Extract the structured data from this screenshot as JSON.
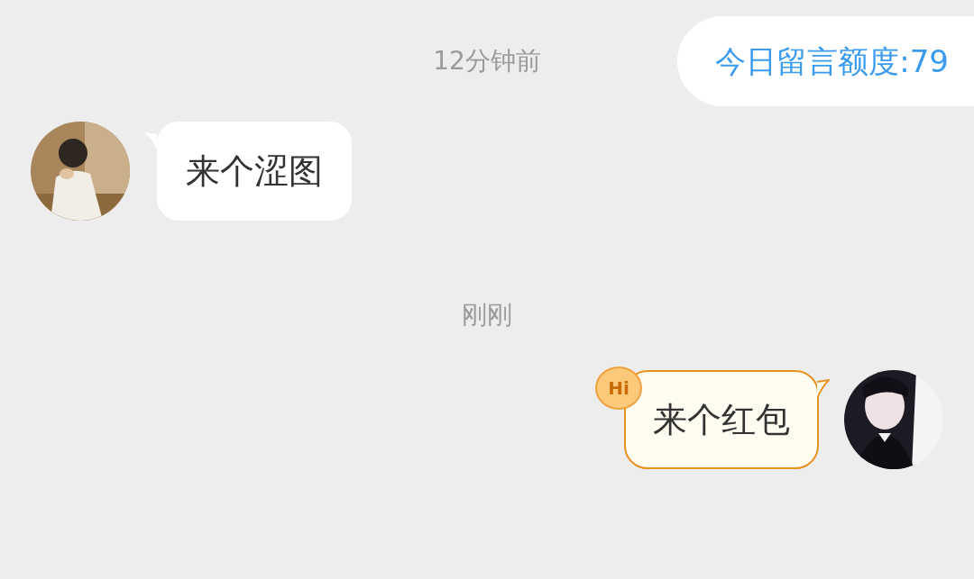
{
  "quota": {
    "text": "今日留言额度:79"
  },
  "timeline": [
    {
      "kind": "time",
      "text": "12分钟前"
    },
    {
      "kind": "incoming",
      "text": "来个涩图"
    },
    {
      "kind": "time",
      "text": "刚刚"
    },
    {
      "kind": "outgoing",
      "text": "来个红包",
      "badge": "Hi"
    }
  ]
}
